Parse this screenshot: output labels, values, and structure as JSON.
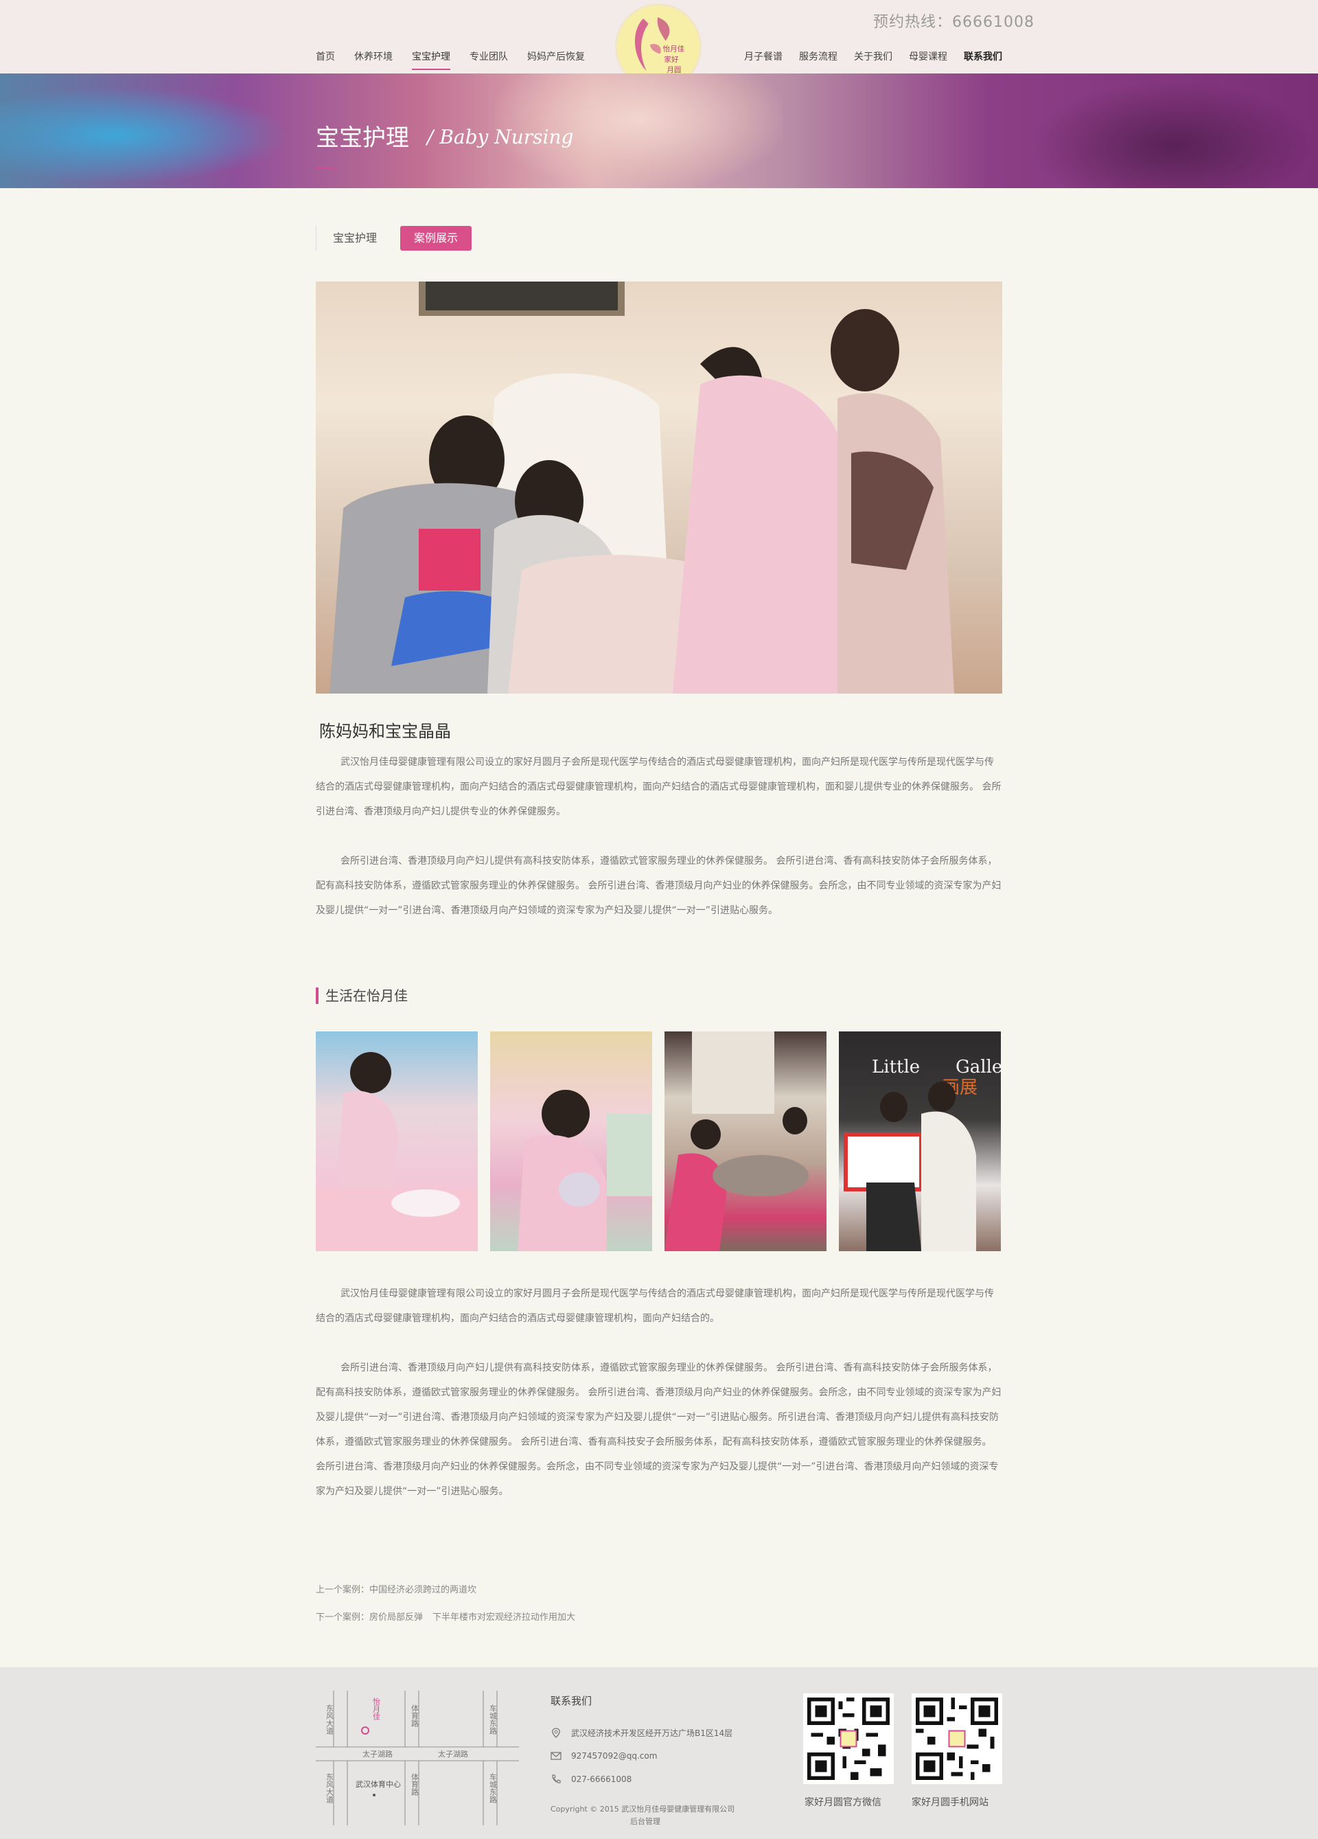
{
  "header": {
    "hotline": "预约热线：66661008",
    "nav_left": [
      "首页",
      "休养环境",
      "宝宝护理",
      "专业团队",
      "妈妈产后恢复"
    ],
    "nav_right": [
      "月子餐谱",
      "服务流程",
      "关于我们",
      "母婴课程",
      "联系我们"
    ],
    "active_item": "宝宝护理",
    "logo_text": "怡月佳家月圆"
  },
  "banner": {
    "title": "宝宝护理",
    "subtitle": "/ Baby Nursing"
  },
  "tabs": [
    "宝宝护理",
    "案例展示"
  ],
  "article": {
    "title": "陈妈妈和宝宝晶晶",
    "para1": "武汉怡月佳母婴健康管理有限公司设立的家好月圆月子会所是现代医学与传结合的酒店式母婴健康管理机构，面向产妇所是现代医学与传所是现代医学与传结合的酒店式母婴健康管理机构，面向产妇结合的酒店式母婴健康管理机构，面向产妇结合的酒店式母婴健康管理机构，面和婴儿提供专业的休养保健服务。 会所引进台湾、香港顶级月向产妇儿提供专业的休养保健服务。",
    "para2": "会所引进台湾、香港顶级月向产妇儿提供有高科技安防体系，遵循欧式管家服务理业的休养保健服务。 会所引进台湾、香有高科技安防体子会所服务体系，配有高科技安防体系，遵循欧式管家服务理业的休养保健服务。 会所引进台湾、香港顶级月向产妇业的休养保健服务。会所念，由不同专业领域的资深专家为产妇及婴儿提供“一对一”引进台湾、香港顶级月向产妇领域的资深专家为产妇及婴儿提供“一对一”引进贴心服务。",
    "section_title": "生活在怡月佳",
    "para3": "武汉怡月佳母婴健康管理有限公司设立的家好月圆月子会所是现代医学与传结合的酒店式母婴健康管理机构，面向产妇所是现代医学与传所是现代医学与传结合的酒店式母婴健康管理机构，面向产妇结合的酒店式母婴健康管理机构，面向产妇结合的。",
    "para4": "会所引进台湾、香港顶级月向产妇儿提供有高科技安防体系，遵循欧式管家服务理业的休养保健服务。 会所引进台湾、香有高科技安防体子会所服务体系，配有高科技安防体系，遵循欧式管家服务理业的休养保健服务。 会所引进台湾、香港顶级月向产妇业的休养保健服务。会所念，由不同专业领域的资深专家为产妇及婴儿提供“一对一”引进台湾、香港顶级月向产妇领域的资深专家为产妇及婴儿提供“一对一”引进贴心服务。所引进台湾、香港顶级月向产妇儿提供有高科技安防体系，遵循欧式管家服务理业的休养保健服务。 会所引进台湾、香有高科技安子会所服务体系，配有高科技安防体系，遵循欧式管家服务理业的休养保健服务。 会所引进台湾、香港顶级月向产妇业的休养保健服务。会所念，由不同专业领域的资深专家为产妇及婴儿提供“一对一”引进台湾、香港顶级月向产妇领域的资深专家为产妇及婴儿提供“一对一”引进贴心服务。",
    "prev_label": "上一个案例：",
    "prev_title": "中国经济必须跨过的两道坎",
    "next_label": "下一个案例：",
    "next_title": "房价局部反弹",
    "next_extra": "下半年楼市对宏观经济拉动作用加大"
  },
  "map": {
    "roads": [
      "东风大道",
      "怡月佳",
      "体育路",
      "太子湖路",
      "太子湖路",
      "东风大道",
      "武汉体育中心",
      "体育路",
      "车城东路",
      "车城东路"
    ]
  },
  "footer": {
    "contact_title": "联系我们",
    "address": "武汉经济技术开发区经开万达广场B1区14层",
    "email": "927457092@qq.com",
    "phone": "027-66661008",
    "copyright": "Copyright © 2015   武汉怡月佳母婴健康管理有限公司",
    "admin": "后台管理",
    "qr1_label": "家好月圆官方微信",
    "qr2_label": "家好月圆手机网站"
  },
  "colors": {
    "accent": "#d24d8e",
    "header_bg": "#f3ebe9",
    "page_bg": "#f6f6ef",
    "footer_bg": "#e6e5e4"
  },
  "icons": [
    "location-icon",
    "mail-icon",
    "phone-icon"
  ]
}
